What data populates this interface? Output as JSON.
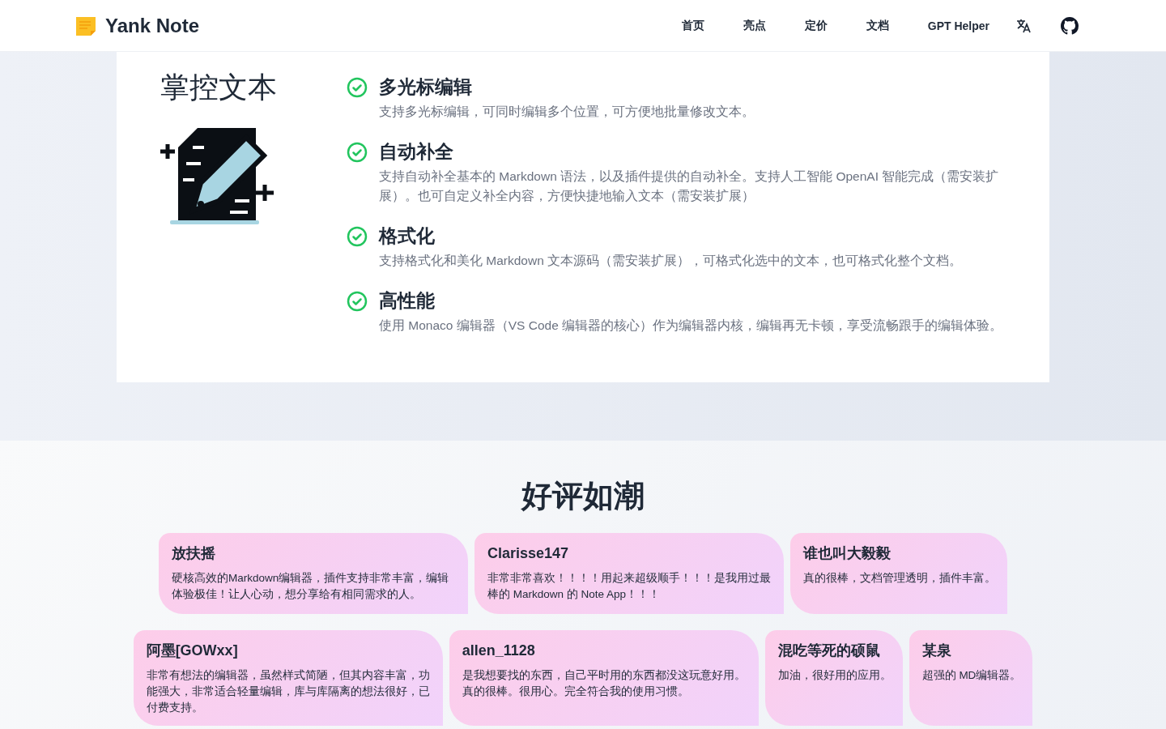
{
  "nav": {
    "brand": "Yank Note",
    "links": [
      {
        "label": "首页"
      },
      {
        "label": "亮点"
      },
      {
        "label": "定价"
      },
      {
        "label": "文档"
      },
      {
        "label": "GPT Helper"
      }
    ]
  },
  "feature_section": {
    "title": "掌控文本",
    "features": [
      {
        "title": "多光标编辑",
        "description": "支持多光标编辑，可同时编辑多个位置，可方便地批量修改文本。"
      },
      {
        "title": "自动补全",
        "description": "支持自动补全基本的 Markdown 语法，以及插件提供的自动补全。支持人工智能 OpenAI 智能完成（需安装扩展）。也可自定义补全内容，方便快捷地输入文本（需安装扩展）"
      },
      {
        "title": "格式化",
        "description": "支持格式化和美化 Markdown 文本源码（需安装扩展），可格式化选中的文本，也可格式化整个文档。"
      },
      {
        "title": "高性能",
        "description": "使用 Monaco 编辑器（VS Code 编辑器的核心）作为编辑器内核，编辑再无卡顿，享受流畅跟手的编辑体验。"
      }
    ]
  },
  "reviews_section": {
    "title": "好评如潮",
    "rows": [
      [
        {
          "author": "放扶摇",
          "text": "硬核高效的Markdown编辑器，插件支持非常丰富，编辑体验极佳！让人心动，想分享给有相同需求的人。"
        },
        {
          "author": "Clarisse147",
          "text": "非常非常喜欢！！！！用起来超级顺手！！！是我用过最棒的 Markdown 的 Note App！！！"
        },
        {
          "author": "谁也叫大毅毅",
          "text": "真的很棒，文档管理透明，插件丰富。"
        }
      ],
      [
        {
          "author": "阿墨[GOWxx]",
          "text": "非常有想法的编辑器，虽然样式简陋，但其内容丰富，功能强大，非常适合轻量编辑，库与库隔离的想法很好，已付费支持。"
        },
        {
          "author": "allen_1128",
          "text": "是我想要找的东西，自己平时用的东西都没这玩意好用。真的很棒。很用心。完全符合我的使用习惯。"
        },
        {
          "author": "混吃等死的硕鼠",
          "text": "加油，很好用的应用。"
        },
        {
          "author": "某泉",
          "text": "超强的 MD编辑器。"
        }
      ]
    ]
  }
}
